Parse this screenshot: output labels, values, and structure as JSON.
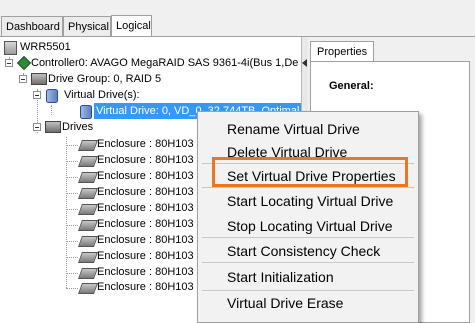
{
  "tabs": [
    "Dashboard",
    "Physical",
    "Logical"
  ],
  "active_tab": "Logical",
  "tree": {
    "server": "WRR5501",
    "controller": "Controller0: AVAGO MegaRAID SAS 9361-4i(Bus 1,De",
    "drive_group": "Drive Group: 0, RAID  5",
    "virtual_drives_label": "Virtual Drive(s):",
    "virtual_drive": "Virtual Drive: 0, VD_0, 32.744TB, Optimal",
    "drives_label": "Drives",
    "enclosures": [
      "Enclosure : 80H103",
      "Enclosure : 80H103",
      "Enclosure : 80H103",
      "Enclosure : 80H103",
      "Enclosure : 80H103",
      "Enclosure : 80H103",
      "Enclosure : 80H103",
      "Enclosure : 80H103",
      "Enclosure : 80H103",
      "Enclosure : 80H103"
    ]
  },
  "properties": {
    "tab_label": "Properties",
    "section_label": "General:"
  },
  "context_menu": {
    "items": [
      "Rename Virtual Drive",
      "Delete Virtual Drive",
      "Set Virtual Drive Properties",
      "Start Locating Virtual Drive",
      "Stop Locating Virtual Drive",
      "Start Consistency Check",
      "Start Initialization",
      "Virtual Drive Erase"
    ],
    "highlighted_item": "Set Virtual Drive Properties",
    "highlight_color": "#e87722"
  }
}
